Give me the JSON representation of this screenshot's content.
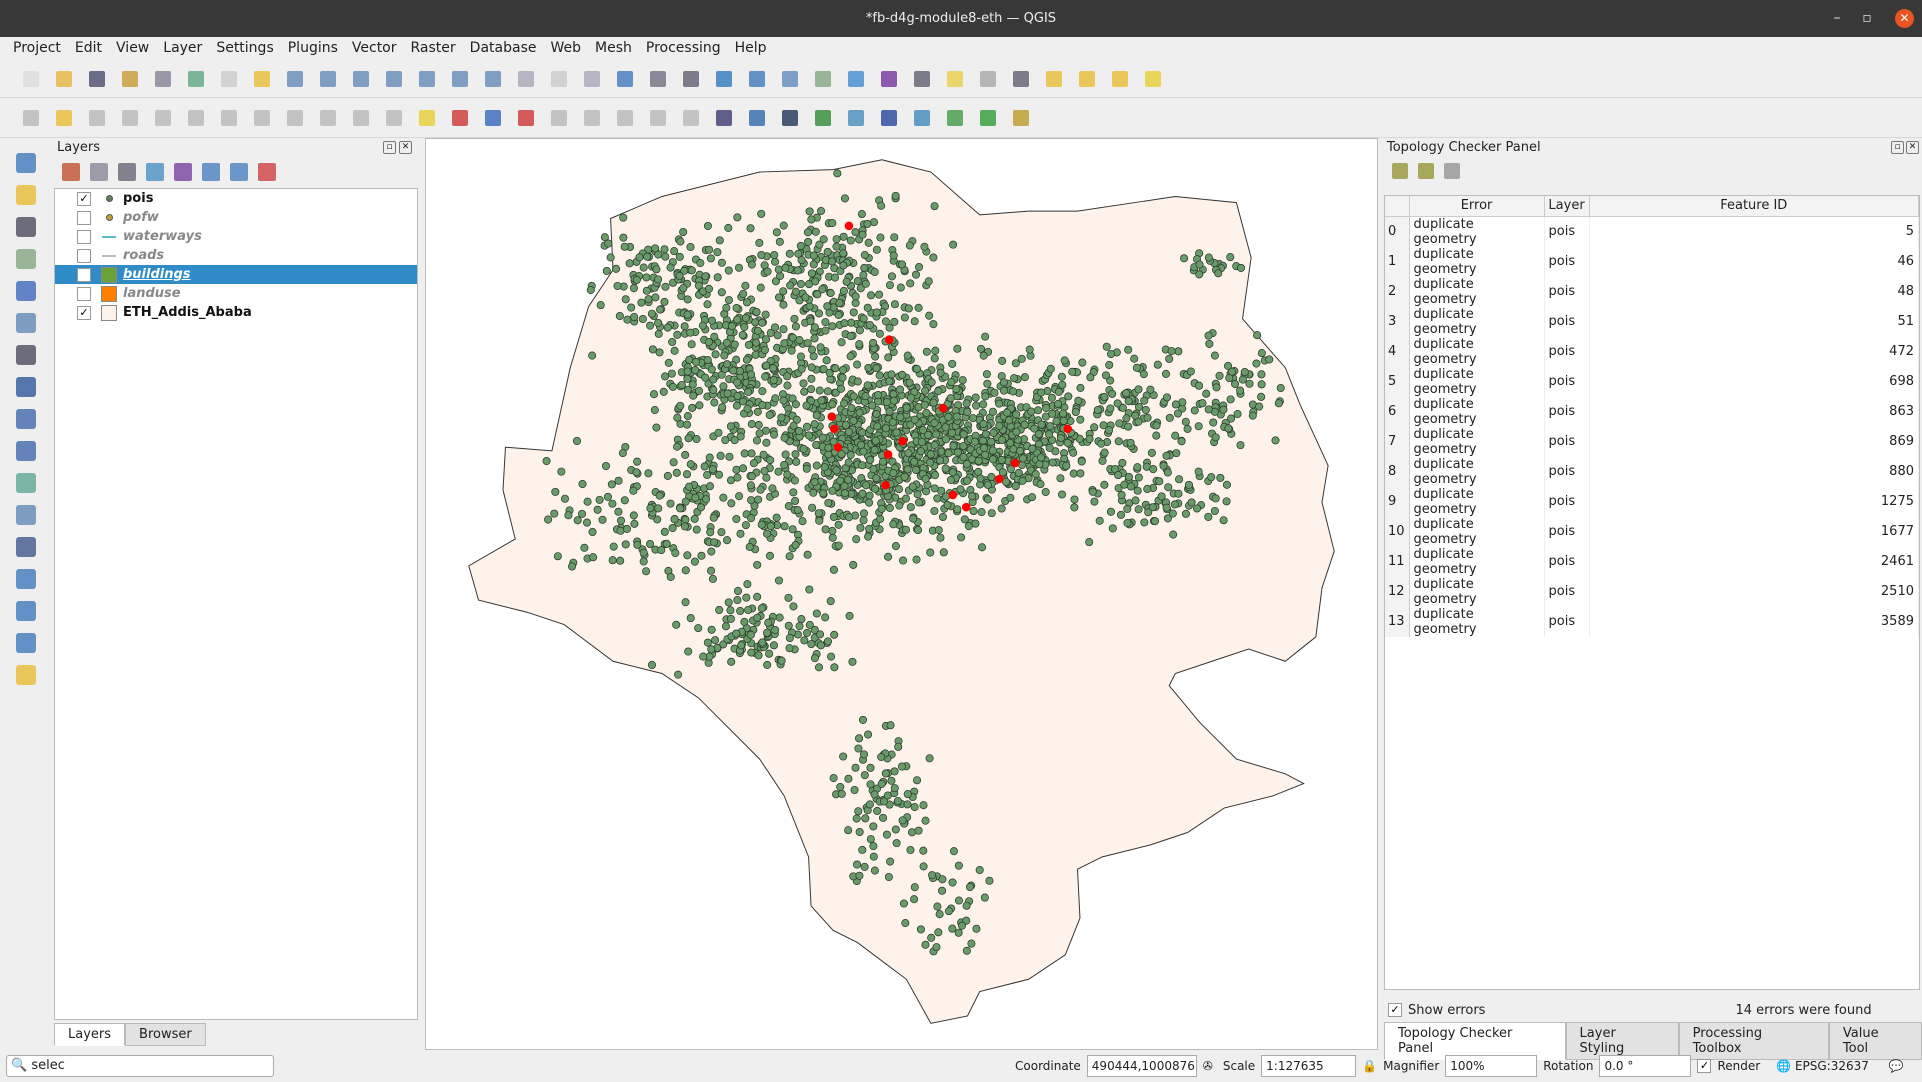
{
  "window": {
    "title": "*fb-d4g-module8-eth — QGIS",
    "minimize": "–",
    "maximize": "▫",
    "close": "✕"
  },
  "menu": [
    "Project",
    "Edit",
    "View",
    "Layer",
    "Settings",
    "Plugins",
    "Vector",
    "Raster",
    "Database",
    "Web",
    "Mesh",
    "Processing",
    "Help"
  ],
  "toolbar1_icons": [
    [
      "new-project-icon",
      "#ddd"
    ],
    [
      "open-project-icon",
      "#e8b84a"
    ],
    [
      "save-project-icon",
      "#557"
    ],
    [
      "new-print-layout-icon",
      "#c8a040"
    ],
    [
      "layout-manager-icon",
      "#889"
    ],
    [
      "style-manager-icon",
      "#6a8"
    ],
    [
      "pan-icon",
      "#ccc"
    ],
    [
      "pan-to-selection-icon",
      "#e8c040"
    ],
    [
      "zoom-in-icon",
      "#6b8fb8"
    ],
    [
      "zoom-out-icon",
      "#6b8fb8"
    ],
    [
      "zoom-full-icon",
      "#6b8fb8"
    ],
    [
      "zoom-to-selection-icon",
      "#6b8fb8"
    ],
    [
      "zoom-to-layer-icon",
      "#6b8fb8"
    ],
    [
      "zoom-native-icon",
      "#6b8fb8"
    ],
    [
      "zoom-last-icon",
      "#6b8fb8"
    ],
    [
      "zoom-next-icon",
      "#aab"
    ],
    [
      "new-map-view-icon",
      "#ccc"
    ],
    [
      "new-3d-view-icon",
      "#aab"
    ],
    [
      "new-bookmark-icon",
      "#4a7fc0"
    ],
    [
      "show-bookmarks-icon",
      "#778"
    ],
    [
      "temporal-controller-icon",
      "#667"
    ],
    [
      "refresh-icon",
      "#3a7fc0"
    ],
    [
      "identify-icon",
      "#4a7fc0"
    ],
    [
      "attribute-table-icon",
      "#6a8fc0"
    ],
    [
      "statistics-icon",
      "#8a8"
    ],
    [
      "settings-icon",
      "#4a90d0"
    ],
    [
      "sum-icon",
      "#7a40a0"
    ],
    [
      "measure-icon",
      "#667"
    ],
    [
      "map-tips-icon",
      "#e8d050"
    ],
    [
      "actions-icon",
      "#aaa"
    ],
    [
      "text-annotation-icon",
      "#667"
    ],
    [
      "select-features-icon",
      "#e8c040"
    ],
    [
      "select-by-expression-icon",
      "#e8c040"
    ],
    [
      "deselect-icon",
      "#e8c040"
    ],
    [
      "select-location-icon",
      "#e8d040"
    ]
  ],
  "toolbar2_icons": [
    [
      "digitize-icon",
      "#bbb"
    ],
    [
      "toggle-editing-icon",
      "#e8c040"
    ],
    [
      "save-edits-icon",
      "#bbb"
    ],
    [
      "add-feature-icon",
      "#bbb"
    ],
    [
      "vertex-tool-icon",
      "#bbb"
    ],
    [
      "modify-attributes-icon",
      "#bbb"
    ],
    [
      "delete-selected-icon",
      "#bbb"
    ],
    [
      "cut-icon",
      "#bbb"
    ],
    [
      "copy-icon",
      "#bbb"
    ],
    [
      "paste-icon",
      "#bbb"
    ],
    [
      "undo-icon",
      "#bbb"
    ],
    [
      "redo-icon",
      "#bbb"
    ],
    [
      "label-tool-icon",
      "#e8d040"
    ],
    [
      "diagram-icon",
      "#d04040"
    ],
    [
      "pin-labels-icon",
      "#4070c0"
    ],
    [
      "show-hide-labels-icon",
      "#d04040"
    ],
    [
      "move-label-icon",
      "#bbb"
    ],
    [
      "rotate-label-icon",
      "#bbb"
    ],
    [
      "change-label-icon",
      "#bbb"
    ],
    [
      "label-prop-icon",
      "#bbb"
    ],
    [
      "label-rule-icon",
      "#bbb"
    ],
    [
      "globe-icon",
      "#447"
    ],
    [
      "python-icon",
      "#3a70b0"
    ],
    [
      "earth-icon",
      "#2a4060"
    ],
    [
      "plugin-info-icon",
      "#3a9040"
    ],
    [
      "plugin-map-icon",
      "#5090c0"
    ],
    [
      "help-icon",
      "#3050a0"
    ],
    [
      "topology-checker-icon",
      "#4a8fc0"
    ],
    [
      "mmqgis-icon",
      "#4aa050"
    ],
    [
      "search-plugin-icon",
      "#3aa040"
    ],
    [
      "tools-icon",
      "#c0a030"
    ]
  ],
  "left_icons": [
    [
      "data-source-manager-icon",
      "#4a80c0"
    ],
    [
      "add-wms-icon",
      "#e8c040"
    ],
    [
      "new-vector-icon",
      "#556"
    ],
    [
      "new-spatialite-icon",
      "#8a8"
    ],
    [
      "add-raster-icon",
      "#4a70c0"
    ],
    [
      "virtual-layer-icon",
      "#6a8fb8"
    ],
    [
      "add-vector-layer-icon",
      "#556"
    ],
    [
      "add-raster-layer-icon",
      "#3a60a0"
    ],
    [
      "add-mesh-icon",
      "#4a70b0"
    ],
    [
      "add-delimited-text-icon",
      "#4a70b0"
    ],
    [
      "add-spatialite-icon",
      "#6a9"
    ],
    [
      "add-virtual-icon",
      "#6a8fb8"
    ],
    [
      "add-postgis-icon",
      "#4a6090"
    ],
    [
      "add-wms-wmts-icon",
      "#4a80c0"
    ],
    [
      "add-wcs-icon",
      "#4a80c0"
    ],
    [
      "add-wfs-icon",
      "#4a80c0"
    ],
    [
      "add-arcgis-icon",
      "#e8c040"
    ]
  ],
  "layers_panel": {
    "title": "Layers",
    "tools": [
      [
        "open-styling-icon",
        "#c05030"
      ],
      [
        "add-group-icon",
        "#889"
      ],
      [
        "manage-visibility-icon",
        "#667"
      ],
      [
        "filter-legend-icon",
        "#4a90c0"
      ],
      [
        "filter-expression-icon",
        "#7a40a0"
      ],
      [
        "expand-all-icon",
        "#4a80c0"
      ],
      [
        "collapse-all-icon",
        "#4a80c0"
      ],
      [
        "remove-layer-icon",
        "#d04040"
      ]
    ],
    "layers": [
      {
        "name": "pois",
        "checked": true,
        "symbol": "point",
        "color": "#5f7f60"
      },
      {
        "name": "pofw",
        "checked": false,
        "symbol": "point",
        "color": "#c0a030"
      },
      {
        "name": "waterways",
        "checked": false,
        "symbol": "line",
        "color": "#5bbcc8"
      },
      {
        "name": "roads",
        "checked": false,
        "symbol": "line",
        "color": "#bbbbbb"
      },
      {
        "name": "buildings",
        "checked": false,
        "symbol": "fill",
        "color": "#6aa03a",
        "selected": true
      },
      {
        "name": "landuse",
        "checked": false,
        "symbol": "fill",
        "color": "#ff8000"
      },
      {
        "name": "ETH_Addis_Ababa",
        "checked": true,
        "symbol": "fill",
        "color": "#fdf3ea"
      }
    ],
    "tabs": [
      "Layers",
      "Browser"
    ]
  },
  "map": {
    "fill": "#fdf3ea",
    "point_color": "#6a9a6a",
    "error_color": "#ff0000"
  },
  "topology": {
    "title": "Topology Checker Panel",
    "tools": [
      [
        "validate-all-icon",
        "#8a8a20"
      ],
      [
        "validate-extent-icon",
        "#8a8a20"
      ],
      [
        "configure-rules-icon",
        "#888"
      ]
    ],
    "columns": [
      "Error",
      "Layer",
      "Feature ID"
    ],
    "rows": [
      [
        "0",
        "duplicate geometry",
        "pois",
        "5"
      ],
      [
        "1",
        "duplicate geometry",
        "pois",
        "46"
      ],
      [
        "2",
        "duplicate geometry",
        "pois",
        "48"
      ],
      [
        "3",
        "duplicate geometry",
        "pois",
        "51"
      ],
      [
        "4",
        "duplicate geometry",
        "pois",
        "472"
      ],
      [
        "5",
        "duplicate geometry",
        "pois",
        "698"
      ],
      [
        "6",
        "duplicate geometry",
        "pois",
        "863"
      ],
      [
        "7",
        "duplicate geometry",
        "pois",
        "869"
      ],
      [
        "8",
        "duplicate geometry",
        "pois",
        "880"
      ],
      [
        "9",
        "duplicate geometry",
        "pois",
        "1275"
      ],
      [
        "10",
        "duplicate geometry",
        "pois",
        "1677"
      ],
      [
        "11",
        "duplicate geometry",
        "pois",
        "2461"
      ],
      [
        "12",
        "duplicate geometry",
        "pois",
        "2510"
      ],
      [
        "13",
        "duplicate geometry",
        "pois",
        "3589"
      ]
    ],
    "show_errors": "Show errors",
    "status": "14 errors were found",
    "tabs": [
      "Topology Checker Panel",
      "Layer Styling",
      "Processing Toolbox",
      "Value Tool"
    ]
  },
  "statusbar": {
    "search": "selec",
    "coordinate_label": "Coordinate",
    "coordinate": "490444,1000876",
    "scale_label": "Scale",
    "scale": "1:127635",
    "magnifier_label": "Magnifier",
    "magnifier": "100%",
    "rotation_label": "Rotation",
    "rotation": "0.0 °",
    "render_label": "Render",
    "crs": "EPSG:32637"
  }
}
